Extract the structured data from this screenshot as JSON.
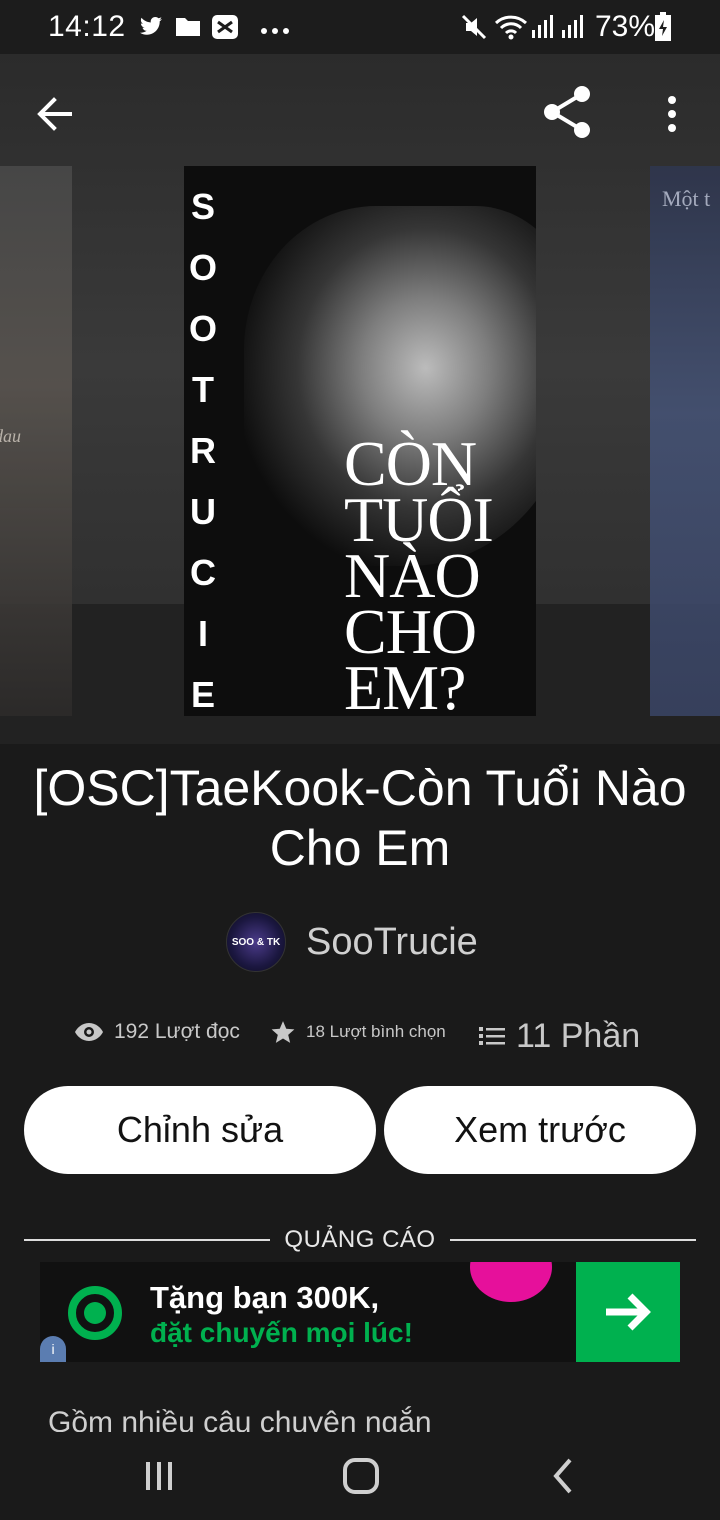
{
  "status_bar": {
    "time": "14:12",
    "battery": "73%",
    "left_icons": [
      "twitter-icon",
      "folder-icon",
      "capcut-icon",
      "more-dots-icon"
    ],
    "right_icons": [
      "mute-icon",
      "wifi-icon",
      "signal-icon",
      "signal-icon",
      "battery-charging-icon"
    ]
  },
  "toolbar": {
    "back_icon": "arrow-left-icon",
    "share_icon": "share-icon",
    "more_icon": "more-vertical-icon"
  },
  "cover": {
    "author_letters": [
      "S",
      "O",
      "O",
      "T",
      "R",
      "U",
      "C",
      "I",
      "E"
    ],
    "title_lines": [
      "CÒN",
      "TUỔI",
      "NÀO",
      "CHO",
      "EM?"
    ],
    "left_side_text": "dau",
    "right_side_text": "Một t"
  },
  "story": {
    "title": "[OSC]TaeKook-Còn Tuổi Nào Cho Em",
    "author": "SooTrucie",
    "avatar_text": "SOO & TK"
  },
  "stats": {
    "reads": "192 Lượt đọc",
    "votes": "18 Lượt bình chọn",
    "parts": "11 Phần"
  },
  "buttons": {
    "edit": "Chỉnh sửa",
    "preview": "Xem trước"
  },
  "ad": {
    "label": "QUẢNG CÁO",
    "line1": "Tặng bạn 300K,",
    "line2": "đặt chuyến mọi lúc!",
    "brand_color": "#00b14f",
    "accent_color": "#e6109b"
  },
  "description_preview": "Gồm nhiều câu chuyện ngắn",
  "nav_bar": [
    "recent-apps-icon",
    "home-icon",
    "back-icon"
  ]
}
